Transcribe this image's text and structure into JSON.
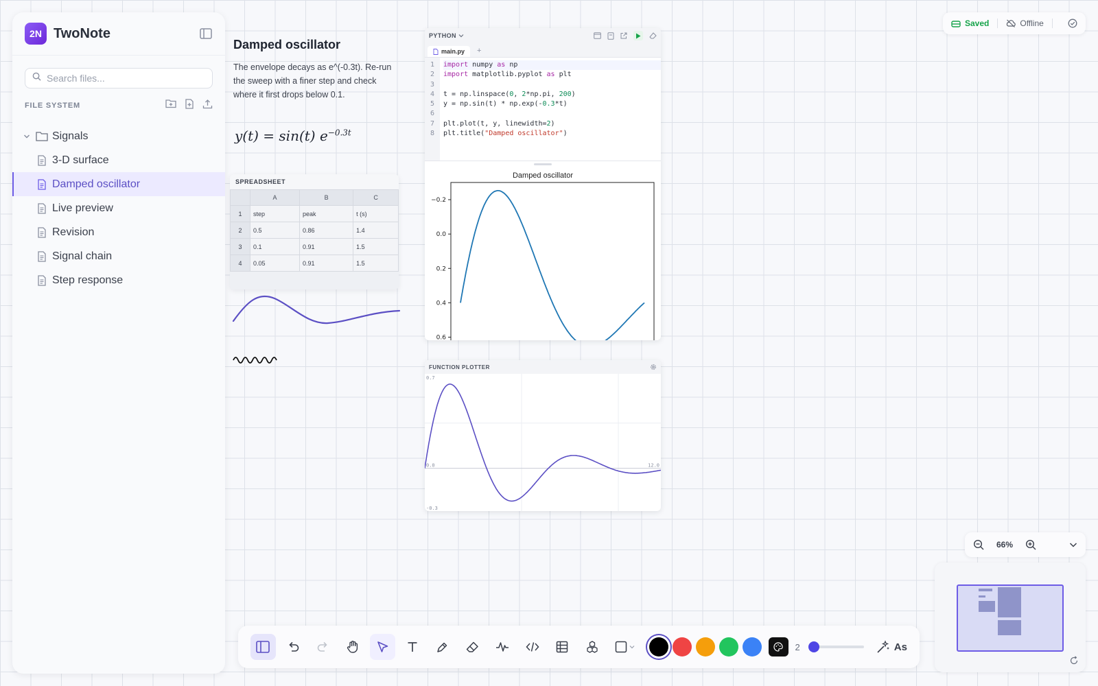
{
  "app": {
    "name": "TwoNote",
    "logo_text": "2N"
  },
  "sidebar": {
    "search_placeholder": "Search files...",
    "section_label": "FILE SYSTEM",
    "folder": "Signals",
    "items": [
      {
        "label": "3-D surface"
      },
      {
        "label": "Damped oscillator"
      },
      {
        "label": "Live preview"
      },
      {
        "label": "Revision"
      },
      {
        "label": "Signal chain"
      },
      {
        "label": "Step response"
      }
    ],
    "active_index": 1
  },
  "note": {
    "title": "Damped oscillator",
    "body": "The envelope decays as e^(-0.3t). Re-run the sweep with a finer step and check where it first drops below 0.1.",
    "formula_lhs": "y(t) = sin(t) e",
    "formula_exp": "−0.3t"
  },
  "spreadsheet": {
    "title": "SPREADSHEET",
    "columns": [
      "A",
      "B",
      "C"
    ],
    "rows": [
      {
        "n": "1",
        "cells": [
          "step",
          "peak",
          "t (s)"
        ]
      },
      {
        "n": "2",
        "cells": [
          "0.5",
          "0.86",
          "1.4"
        ]
      },
      {
        "n": "3",
        "cells": [
          "0.1",
          "0.91",
          "1.5"
        ]
      },
      {
        "n": "4",
        "cells": [
          "0.05",
          "0.91",
          "1.5"
        ]
      }
    ]
  },
  "python": {
    "language": "PYTHON",
    "tab": "main.py",
    "line_numbers": [
      "1",
      "2",
      "3",
      "4",
      "5",
      "6",
      "7",
      "8"
    ],
    "plot_title": "Damped oscillator",
    "y_ticks": [
      "0.6",
      "0.4",
      "0.2",
      "0.0",
      "−0.2"
    ]
  },
  "plotter": {
    "title": "FUNCTION PLOTTER",
    "y_max": "0.7",
    "y_min": "-0.3",
    "x_min": "0.0",
    "x_max": "12.0"
  },
  "chart_data": [
    {
      "type": "line",
      "title": "Damped oscillator",
      "function": "sin(t)*exp(-0.3*t)",
      "x_range": [
        0,
        6.283
      ],
      "ylim": [
        -0.25,
        0.7
      ],
      "y_ticks": [
        -0.2,
        0.0,
        0.2,
        0.4,
        0.6
      ],
      "color": "#1f77b4"
    },
    {
      "type": "line",
      "function": "sin(t)*exp(-0.3*t)",
      "x_range": [
        0,
        12
      ],
      "ylim": [
        -0.3,
        0.7
      ],
      "color": "#5b4fc4"
    }
  ],
  "status": {
    "saved": "Saved",
    "offline": "Offline"
  },
  "zoom": {
    "value": "66%"
  },
  "toolbar": {
    "stroke_width": "2",
    "assist_label": "As"
  },
  "colors": {
    "accent": "#5b4fc4",
    "swatches": [
      "#000000",
      "#ef4444",
      "#f59e0b",
      "#22c55e",
      "#3b82f6"
    ]
  }
}
